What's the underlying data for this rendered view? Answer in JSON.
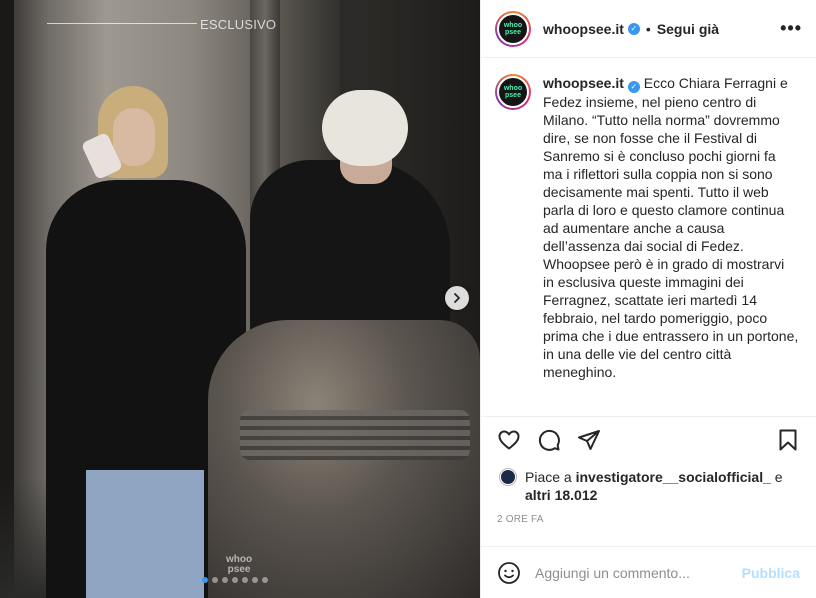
{
  "photo": {
    "overlay_label": "ESCLUSIVO",
    "watermark": "whoo\npsee",
    "dots": 7,
    "active_dot": 0
  },
  "header": {
    "username": "whoopsee.it",
    "separator": "•",
    "follow_label": "Segui già",
    "more_label": "•••",
    "avatar_text": "whoo psee"
  },
  "caption": {
    "username": "whoopsee.it",
    "text": "Ecco Chiara Ferragni e Fedez insieme, nel pieno centro di Milano. “Tutto nella norma” dovremmo dire, se non fosse che il Festival di Sanremo si è concluso pochi giorni fa ma i riflettori sulla coppia non si sono decisamente mai spenti. Tutto il web parla di loro e questo clamore continua ad aumentare anche a causa dell’assenza dai social di Fedez. Whoopsee però è in grado di mostrarvi in esclusiva queste immagini dei Ferragnez, scattate ieri martedì 14 febbraio, nel tardo pomeriggio, poco prima che i due entrassero in un portone, in una delle vie del centro città meneghino."
  },
  "likes": {
    "prefix": "Piace a ",
    "user": "investigatore__socialofficial_",
    "middle": " e",
    "others": "altri 18.012"
  },
  "timestamp": "2 ORE FA",
  "comment": {
    "placeholder": "Aggiungi un commento...",
    "publish_label": "Pubblica"
  },
  "colors": {
    "verified": "#3897f0",
    "publish": "#b2dffc",
    "muted": "#8e8e8e"
  }
}
